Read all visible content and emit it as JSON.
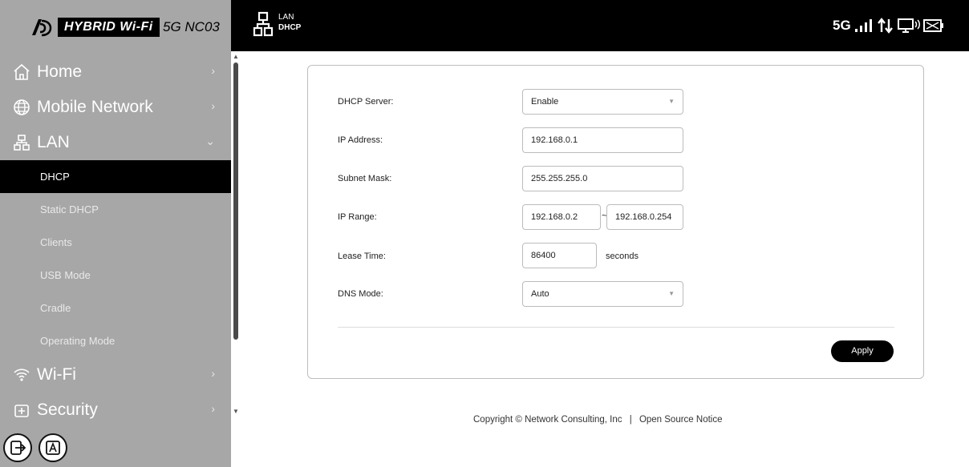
{
  "brand": {
    "product_name": "HYBRID Wi-Fi",
    "model": "5G NC03"
  },
  "header": {
    "breadcrumb_parent": "LAN",
    "breadcrumb_current": "DHCP",
    "network_type": "5G"
  },
  "sidebar": {
    "items": [
      {
        "label": "Home",
        "icon": "home-icon"
      },
      {
        "label": "Mobile Network",
        "icon": "globe-icon"
      },
      {
        "label": "LAN",
        "icon": "lan-icon"
      }
    ],
    "lan_subitems": [
      "DHCP",
      "Static DHCP",
      "Clients",
      "USB Mode",
      "Cradle",
      "Operating Mode"
    ],
    "items_after": [
      {
        "label": "Wi-Fi",
        "icon": "wifi-icon"
      },
      {
        "label": "Security",
        "icon": "shield-icon"
      }
    ]
  },
  "form": {
    "dhcp_server": {
      "label": "DHCP Server:",
      "value": "Enable"
    },
    "ip_address": {
      "label": "IP Address:",
      "value": "192.168.0.1"
    },
    "subnet_mask": {
      "label": "Subnet Mask:",
      "value": "255.255.255.0"
    },
    "ip_range": {
      "label": "IP Range:",
      "start": "192.168.0.2",
      "separator": "~",
      "end": "192.168.0.254"
    },
    "lease_time": {
      "label": "Lease Time:",
      "value": "86400",
      "unit": "seconds"
    },
    "dns_mode": {
      "label": "DNS Mode:",
      "value": "Auto"
    },
    "apply_label": "Apply"
  },
  "footer": {
    "copyright": "Copyright © Network Consulting, Inc",
    "separator": "|",
    "oss_link": "Open Source Notice"
  },
  "colors": {
    "sidebar_bg": "#a7a7a7",
    "active_bg": "#000000",
    "topbar_bg": "#000000",
    "accent": "#000000"
  }
}
